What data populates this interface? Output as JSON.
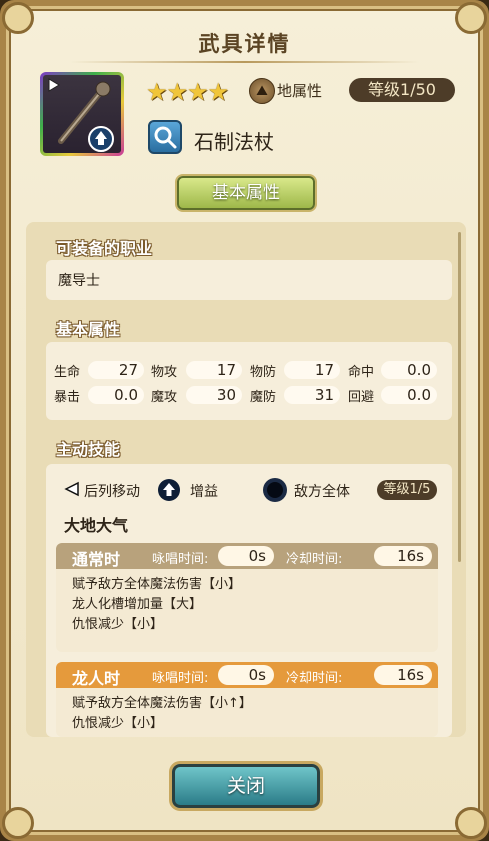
{
  "header": {
    "title": "武具详情"
  },
  "weapon": {
    "name": "石制法杖",
    "stars": "★★★★",
    "attribute_label": "地属性",
    "level_badge": "等级1/50"
  },
  "tab": {
    "label": "基本属性"
  },
  "jobs": {
    "section_title": "可装备的职业",
    "value": "魔导士"
  },
  "stats": {
    "section_title": "基本属性",
    "row1": [
      {
        "label": "生命",
        "value": "27"
      },
      {
        "label": "物攻",
        "value": "17"
      },
      {
        "label": "物防",
        "value": "17"
      },
      {
        "label": "命中",
        "value": "0.0"
      }
    ],
    "row2": [
      {
        "label": "暴击",
        "value": "0.0"
      },
      {
        "label": "魔攻",
        "value": "30"
      },
      {
        "label": "魔防",
        "value": "31"
      },
      {
        "label": "回避",
        "value": "0.0"
      }
    ]
  },
  "skill": {
    "section_title": "主动技能",
    "move_label": "后列移动",
    "buff_label": "增益",
    "target_label": "敌方全体",
    "level_badge": "等级1/5",
    "name": "大地大气",
    "normal": {
      "title": "通常时",
      "cast_label": "咏唱时间:",
      "cast_value": "0s",
      "cd_label": "冷却时间:",
      "cd_value": "16s",
      "lines": [
        "赋予敌方全体魔法伤害【小】",
        "龙人化槽增加量【大】",
        "仇恨减少【小】"
      ]
    },
    "dragon": {
      "title": "龙人时",
      "cast_label": "咏唱时间:",
      "cast_value": "0s",
      "cd_label": "冷却时间:",
      "cd_value": "16s",
      "lines": [
        "赋予敌方全体魔法伤害【小↑】",
        "仇恨减少【小】"
      ]
    }
  },
  "footer": {
    "close_label": "关闭"
  },
  "colors": {
    "normal_header": "#b8a27c",
    "dragon_header": "#e59a3c",
    "accent": "#4d3c28"
  }
}
